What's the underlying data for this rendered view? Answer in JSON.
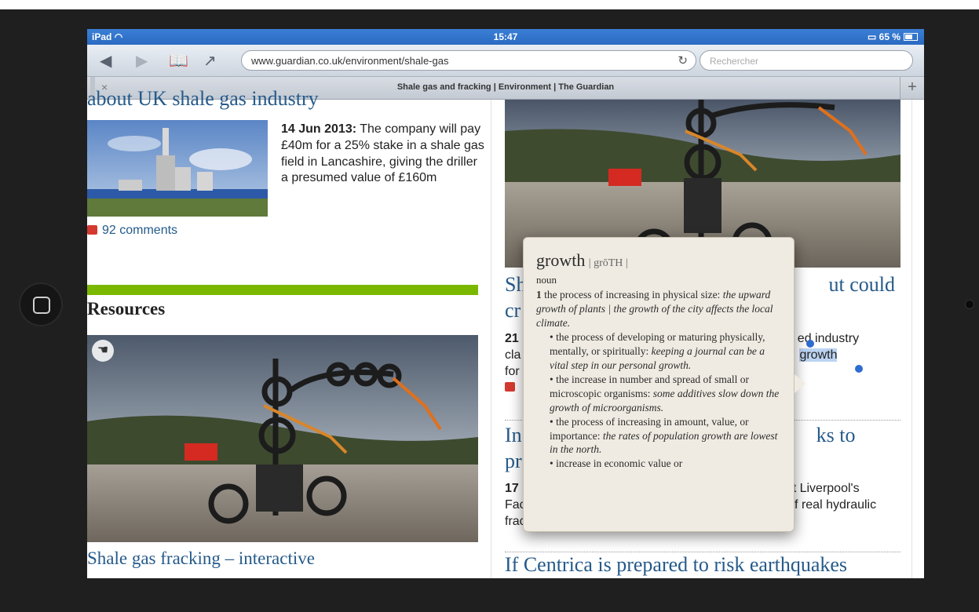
{
  "status": {
    "device": "iPad",
    "time": "15:47",
    "battery": "65 %"
  },
  "browser": {
    "url": "www.guardian.co.uk/environment/shale-gas",
    "search_placeholder": "Rechercher",
    "tab_title": "Shale gas and fracking | Environment | The Guardian",
    "tab_close": "×",
    "tab_add": "+"
  },
  "left": {
    "cut_headline": "about UK shale gas industry",
    "article_date": "14 Jun 2013:",
    "article_text": " The company will pay £40m for a 25% stake in a shale gas field in Lancashire, giving the driller a presumed value of £160m",
    "comments": "92 comments",
    "section": "Resources",
    "interactive_title": "Shale gas fracking – interactive"
  },
  "right": {
    "h1_a": "Sh",
    "h1_b": "ut could",
    "h1_c": "cr",
    "t1_a": "21",
    "t1_b": "ed industry",
    "t1_c": "cla",
    "t1_sel": "growth",
    "t1_d": "for",
    "h2_a": "In",
    "h2_b": "ks to",
    "h2_c": "pr",
    "t2_a": "17",
    "t2_b": "at Liverpool's",
    "t2_c": "Fact gallery recreates sounds, tremors and flames of real hydraulic fracturing operation",
    "h3": "If Centrica is prepared to risk earthquakes"
  },
  "dictionary": {
    "word": "growth",
    "pron": "| grōTH |",
    "pos": "noun",
    "sense_num": "1",
    "d1": "the process of increasing in physical size:",
    "e1": "the upward growth of plants | the growth of the city affects the local climate.",
    "d2": "• the process of developing or maturing physically, mentally, or spiritually:",
    "e2": "keeping a journal can be a vital step in our personal growth.",
    "d3": "• the increase in number and spread of small or microscopic organisms:",
    "e3": "some additives slow down the growth of microorganisms.",
    "d4": "• the process of increasing in amount, value, or importance:",
    "e4": "the rates of population growth are lowest in the north.",
    "d5": "• increase in economic value or"
  }
}
